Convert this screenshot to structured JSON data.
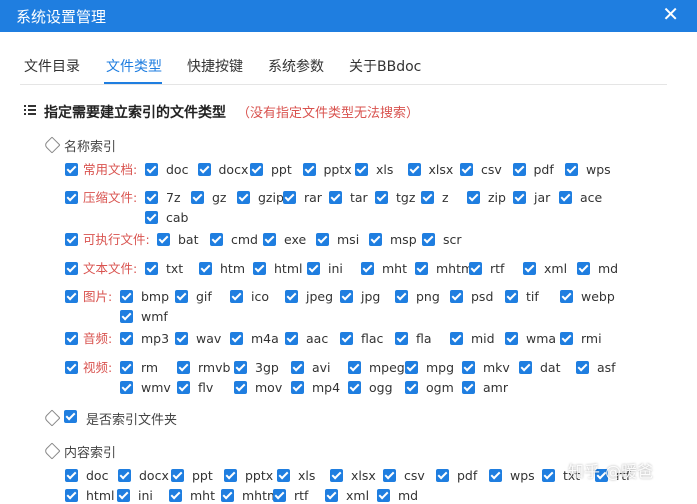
{
  "window": {
    "title": "系统设置管理"
  },
  "tabs": [
    "文件目录",
    "文件类型",
    "快捷按键",
    "系统参数",
    "关于BBdoc"
  ],
  "section": {
    "heading": "指定需要建立索引的文件类型",
    "warning": "（没有指定文件类型无法搜索）"
  },
  "name_index": {
    "label": "名称索引",
    "groups": [
      {
        "label": "常用文档:",
        "types": [
          "doc",
          "docx",
          "ppt",
          "pptx",
          "xls",
          "xlsx",
          "csv",
          "pdf",
          "wps"
        ]
      },
      {
        "label": "压缩文件:",
        "types": [
          "7z",
          "gz",
          "gzip",
          "rar",
          "tar",
          "tgz",
          "z",
          "zip",
          "jar",
          "ace",
          "cab"
        ]
      },
      {
        "label": "可执行文件:",
        "types": [
          "bat",
          "cmd",
          "exe",
          "msi",
          "msp",
          "scr"
        ]
      },
      {
        "label": "文本文件:",
        "types": [
          "txt",
          "htm",
          "html",
          "ini",
          "mht",
          "mhtml",
          "rtf",
          "xml",
          "md"
        ]
      },
      {
        "label": "图片:",
        "types": [
          "bmp",
          "gif",
          "ico",
          "jpeg",
          "jpg",
          "png",
          "psd",
          "tif",
          "webp",
          "wmf"
        ]
      },
      {
        "label": "音频:",
        "types": [
          "mp3",
          "wav",
          "m4a",
          "aac",
          "flac",
          "fla",
          "mid",
          "wma",
          "rmi"
        ]
      },
      {
        "label": "视频:",
        "types": [
          "rm",
          "rmvb",
          "3gp",
          "avi",
          "mpeg",
          "mpg",
          "mkv",
          "dat",
          "asf",
          "wmv",
          "flv",
          "mov",
          "mp4",
          "ogg",
          "ogm",
          "amr"
        ]
      }
    ]
  },
  "folder_index": {
    "label": "是否索引文件夹"
  },
  "content_index": {
    "label": "内容索引",
    "row1": [
      "doc",
      "docx",
      "ppt",
      "pptx",
      "xls",
      "xlsx",
      "csv",
      "pdf",
      "wps",
      "txt",
      "rtf"
    ],
    "row2": [
      "html",
      "ini",
      "mht",
      "mhtml",
      "rtf",
      "xml",
      "md"
    ]
  },
  "watermark": "知乎 @暖爸",
  "colors": {
    "accent": "#1f7ee0",
    "warning": "#d9534f"
  }
}
